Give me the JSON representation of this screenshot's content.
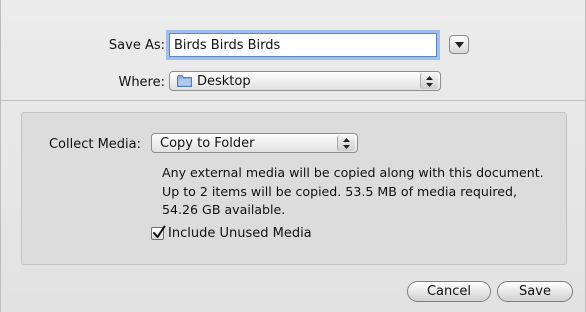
{
  "save_as": {
    "label": "Save As:",
    "value": "Birds Birds Birds"
  },
  "where": {
    "label": "Where:",
    "selected": "Desktop",
    "icon": "folder-icon"
  },
  "collect_media": {
    "label": "Collect Media:",
    "selected": "Copy to Folder",
    "info_lines": [
      "Any external media will be copied along with this document.",
      "Up to 2 items will be copied. 53.5 MB of media required,",
      "54.26 GB available."
    ],
    "include_unused": {
      "label": "Include Unused Media",
      "checked": true
    }
  },
  "buttons": {
    "cancel": "Cancel",
    "save": "Save"
  }
}
